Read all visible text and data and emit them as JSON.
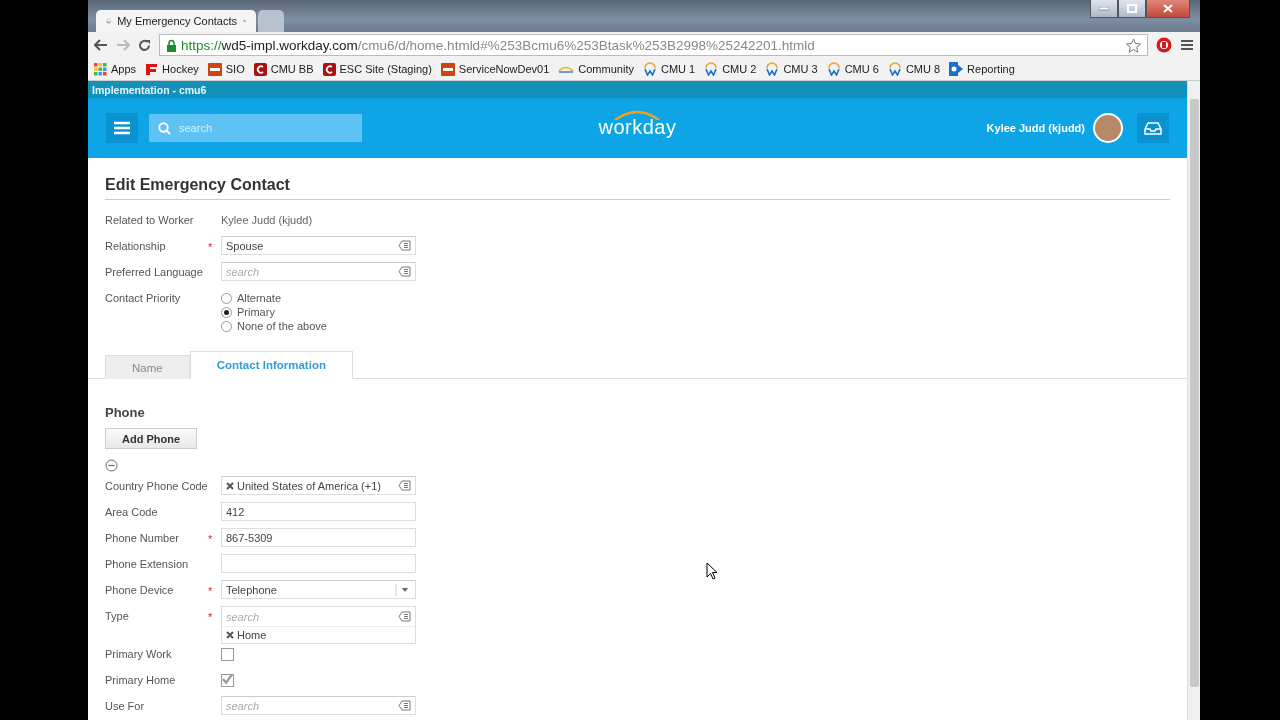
{
  "browser": {
    "tabs": [
      {
        "title": "My Emergency Contacts",
        "selected": true
      },
      {
        "selected": false
      }
    ],
    "url": {
      "scheme": "https://",
      "host": "wd5-impl.workday.com",
      "path": "/cmu6/d/home.htmld#%253Bcmu6%253Btask%253B2998%25242201.htmld"
    },
    "bookmarks": [
      {
        "label": "Apps",
        "kind": "apps"
      },
      {
        "label": "Hockey",
        "kind": "hockey"
      },
      {
        "label": "SIO",
        "kind": "redbox"
      },
      {
        "label": "CMU BB",
        "kind": "cmu"
      },
      {
        "label": "ESC Site (Staging)",
        "kind": "cmu"
      },
      {
        "label": "ServiceNowDev01",
        "kind": "redbox"
      },
      {
        "label": "Community",
        "kind": "community"
      },
      {
        "label": "CMU 1",
        "kind": "workday"
      },
      {
        "label": "CMU 2",
        "kind": "workday"
      },
      {
        "label": "CMU 3",
        "kind": "workday"
      },
      {
        "label": "CMU 6",
        "kind": "workday"
      },
      {
        "label": "CMU 8",
        "kind": "workday"
      },
      {
        "label": "Reporting",
        "kind": "sharepoint"
      }
    ]
  },
  "environment_bar": "Implementation - cmu6",
  "header": {
    "search_placeholder": "search",
    "logo": "workday",
    "user": "Kylee Judd (kjudd)"
  },
  "page": {
    "title": "Edit Emergency Contact",
    "fields": [
      {
        "kind": "text",
        "label": "Related to Worker",
        "value": "Kylee Judd (kjudd)"
      },
      {
        "kind": "prompt",
        "label": "Relationship",
        "required_mark": "*",
        "value": "Spouse"
      },
      {
        "kind": "prompt",
        "label": "Preferred Language",
        "placeholder": "search"
      },
      {
        "kind": "radio",
        "label": "Contact Priority",
        "options": [
          {
            "label": "Alternate",
            "selected": false
          },
          {
            "label": "Primary",
            "selected": true
          },
          {
            "label": "None of the above",
            "selected": false
          }
        ]
      }
    ],
    "tabs": [
      {
        "label": "Name",
        "selected": false
      },
      {
        "label": "Contact Information",
        "selected": true
      }
    ],
    "section": {
      "title": "Phone",
      "add_button": "Add Phone",
      "fields": [
        {
          "kind": "prompt",
          "label": "Country Phone Code",
          "selected_items": [
            "United States of America (+1)"
          ]
        },
        {
          "kind": "input",
          "label": "Area Code",
          "value": "412"
        },
        {
          "kind": "input",
          "label": "Phone Number",
          "required_mark": "*",
          "value": "867-5309"
        },
        {
          "kind": "input",
          "label": "Phone Extension"
        },
        {
          "kind": "dropdown",
          "label": "Phone Device",
          "required_mark": "*",
          "value": "Telephone"
        },
        {
          "kind": "prompt",
          "label": "Type",
          "required_mark": "*",
          "placeholder": "search",
          "selected_items": [
            "Home"
          ]
        },
        {
          "kind": "checkbox",
          "label": "Primary Work",
          "checked": false
        },
        {
          "kind": "checkbox",
          "label": "Primary Home",
          "checked": true
        },
        {
          "kind": "prompt",
          "label": "Use For",
          "placeholder": "search"
        }
      ]
    }
  }
}
